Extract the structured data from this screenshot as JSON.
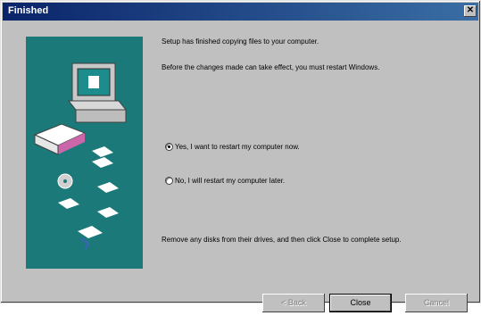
{
  "window": {
    "title": "Finished"
  },
  "content": {
    "line1": "Setup has finished copying files to your computer.",
    "line2": "Before the changes made can take effect, you must restart Windows.",
    "option_yes": "Yes, I want to restart my computer now.",
    "option_no": "No, I will restart my computer later.",
    "footer": "Remove any disks from their drives, and then click Close to complete setup.",
    "selected_option": "yes"
  },
  "buttons": {
    "back": "< Back",
    "close": "Close",
    "cancel": "Cancel"
  },
  "colors": {
    "panel_teal": "#1b7a79",
    "title_blue": "#0a246a",
    "dialog_gray": "#c0c0c0"
  }
}
